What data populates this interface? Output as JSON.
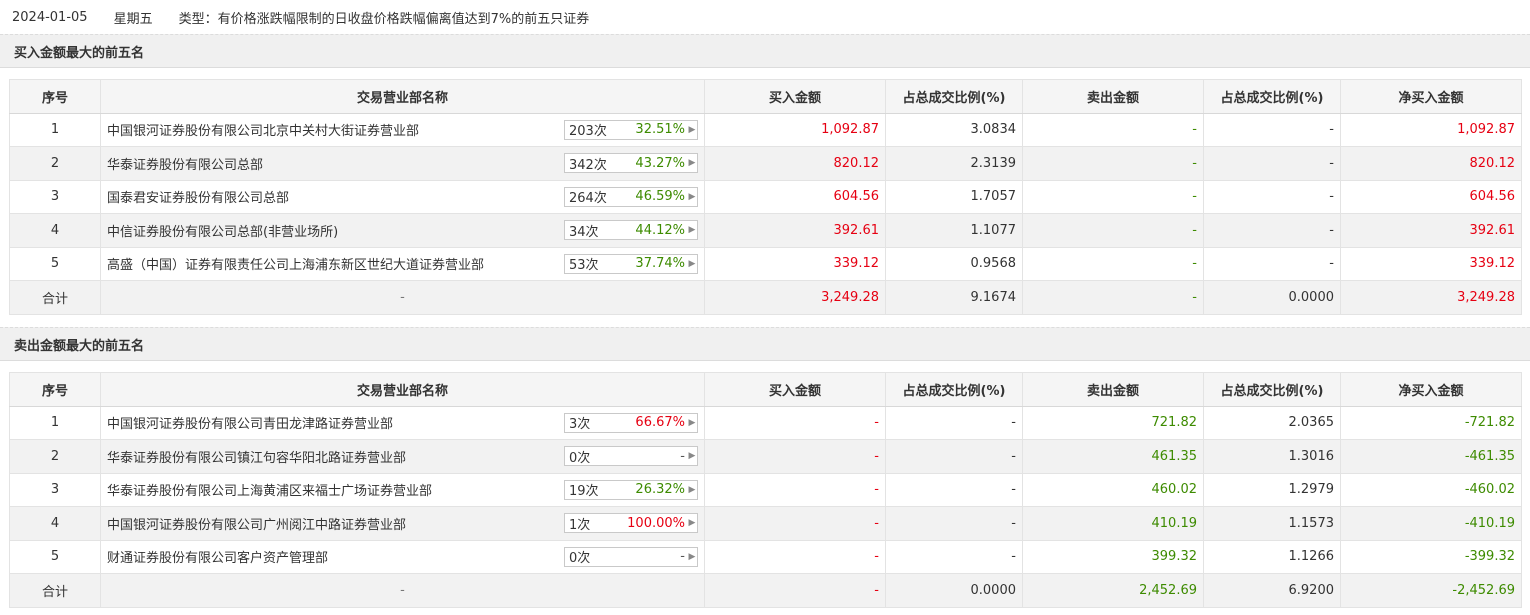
{
  "header": {
    "date": "2024-01-05",
    "weekday": "星期五",
    "type_text": "类型：有价格涨跌幅限制的日收盘价格跌幅偏离值达到7%的前五只证券"
  },
  "columns": {
    "seq": "序号",
    "name": "交易营业部名称",
    "buy": "买入金额",
    "buy_pct": "占总成交比例(%)",
    "sell": "卖出金额",
    "sell_pct": "占总成交比例(%)",
    "net": "净买入金额"
  },
  "buy_section": {
    "title": "买入金额最大的前五名",
    "rows": [
      {
        "seq": "1",
        "name": "中国银河证券股份有限公司北京中关村大街证券营业部",
        "count": "203次",
        "rate": "32.51%",
        "buy": "1,092.87",
        "buy_pct": "3.0834",
        "sell": "-",
        "sell_pct": "-",
        "net": "1,092.87"
      },
      {
        "seq": "2",
        "name": "华泰证券股份有限公司总部",
        "count": "342次",
        "rate": "43.27%",
        "buy": "820.12",
        "buy_pct": "2.3139",
        "sell": "-",
        "sell_pct": "-",
        "net": "820.12"
      },
      {
        "seq": "3",
        "name": "国泰君安证券股份有限公司总部",
        "count": "264次",
        "rate": "46.59%",
        "buy": "604.56",
        "buy_pct": "1.7057",
        "sell": "-",
        "sell_pct": "-",
        "net": "604.56"
      },
      {
        "seq": "4",
        "name": "中信证券股份有限公司总部(非营业场所)",
        "count": "34次",
        "rate": "44.12%",
        "buy": "392.61",
        "buy_pct": "1.1077",
        "sell": "-",
        "sell_pct": "-",
        "net": "392.61"
      },
      {
        "seq": "5",
        "name": "高盛（中国）证券有限责任公司上海浦东新区世纪大道证券营业部",
        "count": "53次",
        "rate": "37.74%",
        "buy": "339.12",
        "buy_pct": "0.9568",
        "sell": "-",
        "sell_pct": "-",
        "net": "339.12"
      }
    ],
    "total": {
      "label": "合计",
      "name": "-",
      "buy": "3,249.28",
      "buy_pct": "9.1674",
      "sell": "-",
      "sell_pct": "0.0000",
      "net": "3,249.28"
    }
  },
  "sell_section": {
    "title": "卖出金额最大的前五名",
    "rows": [
      {
        "seq": "1",
        "name": "中国银河证券股份有限公司青田龙津路证券营业部",
        "count": "3次",
        "rate": "66.67%",
        "rate_color": "red",
        "buy": "-",
        "buy_pct": "-",
        "sell": "721.82",
        "sell_pct": "2.0365",
        "net": "-721.82"
      },
      {
        "seq": "2",
        "name": "华泰证券股份有限公司镇江句容华阳北路证券营业部",
        "count": "0次",
        "rate": "-",
        "rate_color": "gray",
        "buy": "-",
        "buy_pct": "-",
        "sell": "461.35",
        "sell_pct": "1.3016",
        "net": "-461.35"
      },
      {
        "seq": "3",
        "name": "华泰证券股份有限公司上海黄浦区来福士广场证券营业部",
        "count": "19次",
        "rate": "26.32%",
        "rate_color": "green",
        "buy": "-",
        "buy_pct": "-",
        "sell": "460.02",
        "sell_pct": "1.2979",
        "net": "-460.02"
      },
      {
        "seq": "4",
        "name": "中国银河证券股份有限公司广州阅江中路证券营业部",
        "count": "1次",
        "rate": "100.00%",
        "rate_color": "red",
        "buy": "-",
        "buy_pct": "-",
        "sell": "410.19",
        "sell_pct": "1.1573",
        "net": "-410.19"
      },
      {
        "seq": "5",
        "name": "财通证券股份有限公司客户资产管理部",
        "count": "0次",
        "rate": "-",
        "rate_color": "gray",
        "buy": "-",
        "buy_pct": "-",
        "sell": "399.32",
        "sell_pct": "1.1266",
        "net": "-399.32"
      }
    ],
    "total": {
      "label": "合计",
      "name": "-",
      "buy": "-",
      "buy_pct": "0.0000",
      "sell": "2,452.69",
      "sell_pct": "6.9200",
      "net": "-2,452.69"
    }
  },
  "colors": {
    "up": "#e60012",
    "down": "#3d8b00",
    "header_bg": "#f5f5f5",
    "stripe_bg": "#f2f2f2"
  },
  "icons": {
    "row_expand": "caret-right-icon"
  }
}
